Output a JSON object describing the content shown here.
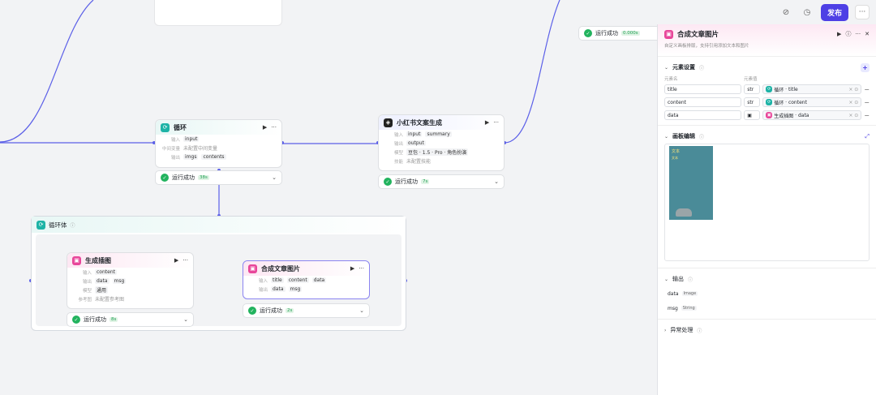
{
  "topbar": {
    "publish_label": "发布",
    "more_label": "···"
  },
  "status_top": {
    "label": "运行成功",
    "time": "0.000s"
  },
  "loop_node": {
    "title": "循环",
    "input_label": "输入",
    "input_tag": "input",
    "mid_label": "中间变量",
    "mid_value": "未配置中间变量",
    "output_label": "输出",
    "out1": "imgs",
    "out2": "contents",
    "status": "运行成功",
    "time": "38s"
  },
  "xhs_node": {
    "title": "小红书文案生成",
    "input_label": "输入",
    "input_tag": "input",
    "output_label": "输出",
    "output_tag": "output",
    "model_label": "模型",
    "model_value": "豆包 · 1.5 · Pro · 角色扮演",
    "skill_label": "技能",
    "skill_value": "未配置技能",
    "status": "运行成功",
    "time": "7s"
  },
  "summary_tag": "summary",
  "loop_body": {
    "title": "循环体"
  },
  "gen_node": {
    "title": "生成插图",
    "input_label": "输入",
    "input_tag": "content",
    "output_label": "输出",
    "out1": "data",
    "out2": "msg",
    "model_label": "模型",
    "model_value": "通用",
    "ref_label": "参考图",
    "ref_value": "未配置参考图",
    "status": "运行成功",
    "time": "8s"
  },
  "compose_node": {
    "title": "合成文章图片",
    "input_label": "输入",
    "in1": "title",
    "in2": "content",
    "in3": "data",
    "output_label": "输出",
    "out1": "data",
    "out2": "msg",
    "status": "运行成功",
    "time": "2s"
  },
  "panel": {
    "title": "合成文章图片",
    "desc": "自定义画板排版，支持引用添加文本和图片",
    "elements_title": "元素设置",
    "col_name": "元素名",
    "col_value": "元素值",
    "rows": [
      {
        "name": "title",
        "type": "str",
        "src": "循环",
        "field": "title"
      },
      {
        "name": "content",
        "type": "str",
        "src": "循环",
        "field": "content"
      },
      {
        "name": "data",
        "type": "img",
        "src": "生成插图",
        "field": "data"
      }
    ],
    "canvas_title": "画板编辑",
    "thumb_title": "文本",
    "thumb_sub": "文本",
    "output_title": "输出",
    "outputs": [
      {
        "name": "data",
        "type": "Image"
      },
      {
        "name": "msg",
        "type": "String"
      }
    ],
    "error_title": "异常处理"
  },
  "colors": {
    "accent": "#4e40e5",
    "wire": "#5b5fe8",
    "success": "#22b35e"
  }
}
